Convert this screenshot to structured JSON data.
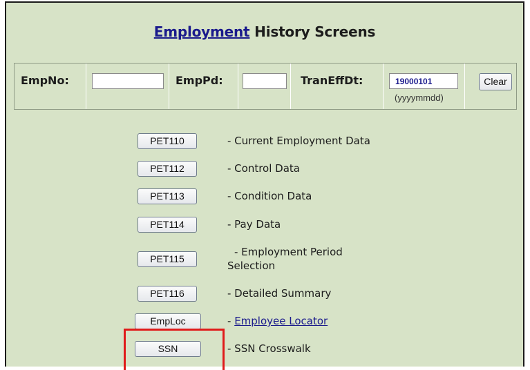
{
  "header": {
    "title_link": "Employment",
    "title_rest": " History Screens"
  },
  "filters": {
    "emp_no_label": "EmpNo:",
    "emp_no_value": "",
    "emp_pd_label": "EmpPd:",
    "emp_pd_value": "",
    "tran_label": "TranEffDt:",
    "tran_value": "19000101",
    "tran_hint": "(yyyymmdd)",
    "clear_label": "Clear"
  },
  "screens": [
    {
      "button": "PET110",
      "desc": "- Current Employment Data"
    },
    {
      "button": "PET112",
      "desc": "- Control Data"
    },
    {
      "button": "PET113",
      "desc": "- Condition Data"
    },
    {
      "button": "PET114",
      "desc": "- Pay Data"
    },
    {
      "button": "PET115",
      "desc_line1": "- Employment Period",
      "desc_line2": "Selection"
    },
    {
      "button": "PET116",
      "desc": "- Detailed Summary"
    },
    {
      "button": "EmpLoc",
      "desc_prefix": "- ",
      "desc_link": "Employee Locator"
    },
    {
      "button": "SSN",
      "desc": "- SSN Crosswalk"
    }
  ],
  "colors": {
    "panel_bg": "#d7e3c7",
    "link": "#1a1a8c",
    "highlight": "#e01a1a"
  }
}
